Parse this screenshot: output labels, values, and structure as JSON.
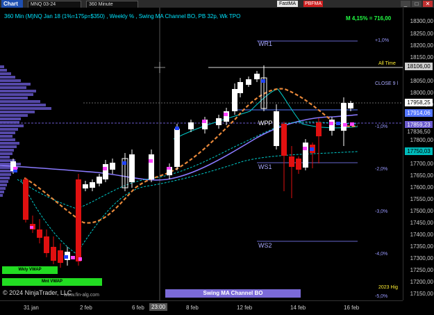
{
  "toolbar": {
    "chart_label": "Chart",
    "instrument": "MNQ 03-24",
    "timeframe": "360 Minute",
    "btn_fastma": "FastMA",
    "btn_pbfma": "PBFMA",
    "win_min": "_",
    "win_max": "□",
    "win_close": "✕"
  },
  "chart_title": "360 Min (M)NQ Jan 18 (1%=175p=$350) , Weekly % , Swing MA Channel BO, PB 32p, Wk TPO",
  "m_label": "M 4,15% = 716,00",
  "levels": {
    "wr1": "WR1",
    "wpp": "WPP",
    "ws1": "WS1",
    "ws2": "WS2",
    "close9": "CLOSE 9 l"
  },
  "pct_labels": [
    "+1,0%",
    "-1,0%",
    "-2,0%",
    "-3,0%",
    "-4,0%",
    "-5,0%"
  ],
  "price_ticks": [
    "18300,00",
    "18250,00",
    "18200,00",
    "18150,00",
    "18050,00",
    "18000,00",
    "17950,00",
    "17800,00",
    "17700,00",
    "17650,00",
    "17600,00",
    "17550,00",
    "17500,00",
    "17450,00",
    "17400,00",
    "17350,00",
    "17300,00",
    "17250,00",
    "17200,00",
    "17150,00"
  ],
  "price_boxes": {
    "all_time": "18106,00",
    "last": "17958,25",
    "p17914": "17914,06",
    "p17859": "17859,23",
    "p17836": "17836,50",
    "p17750": "17750,03"
  },
  "all_time_label": "All Time",
  "hig_label": "2023 Hig",
  "x_labels": [
    "31 jan",
    "2 feb",
    "6 feb",
    "23:00",
    "8 feb",
    "12 feb",
    "14 feb",
    "16 feb"
  ],
  "vwap": {
    "weekly": "Wkly VWAP",
    "monthly": "Mnt VWAP"
  },
  "footer": {
    "copyright": "© 2024 NinjaTrader, LLC",
    "site": "www.fin-alg.com",
    "swing_label": "Swing MA Channel BO"
  },
  "colors": {
    "up_candle": "#ffffff",
    "down_candle": "#e01010",
    "ma_orange": "#e8883a",
    "ma_purple": "#8a7aff",
    "channel_cyan": "#00cccc",
    "vwap_green": "#22dd22"
  }
}
